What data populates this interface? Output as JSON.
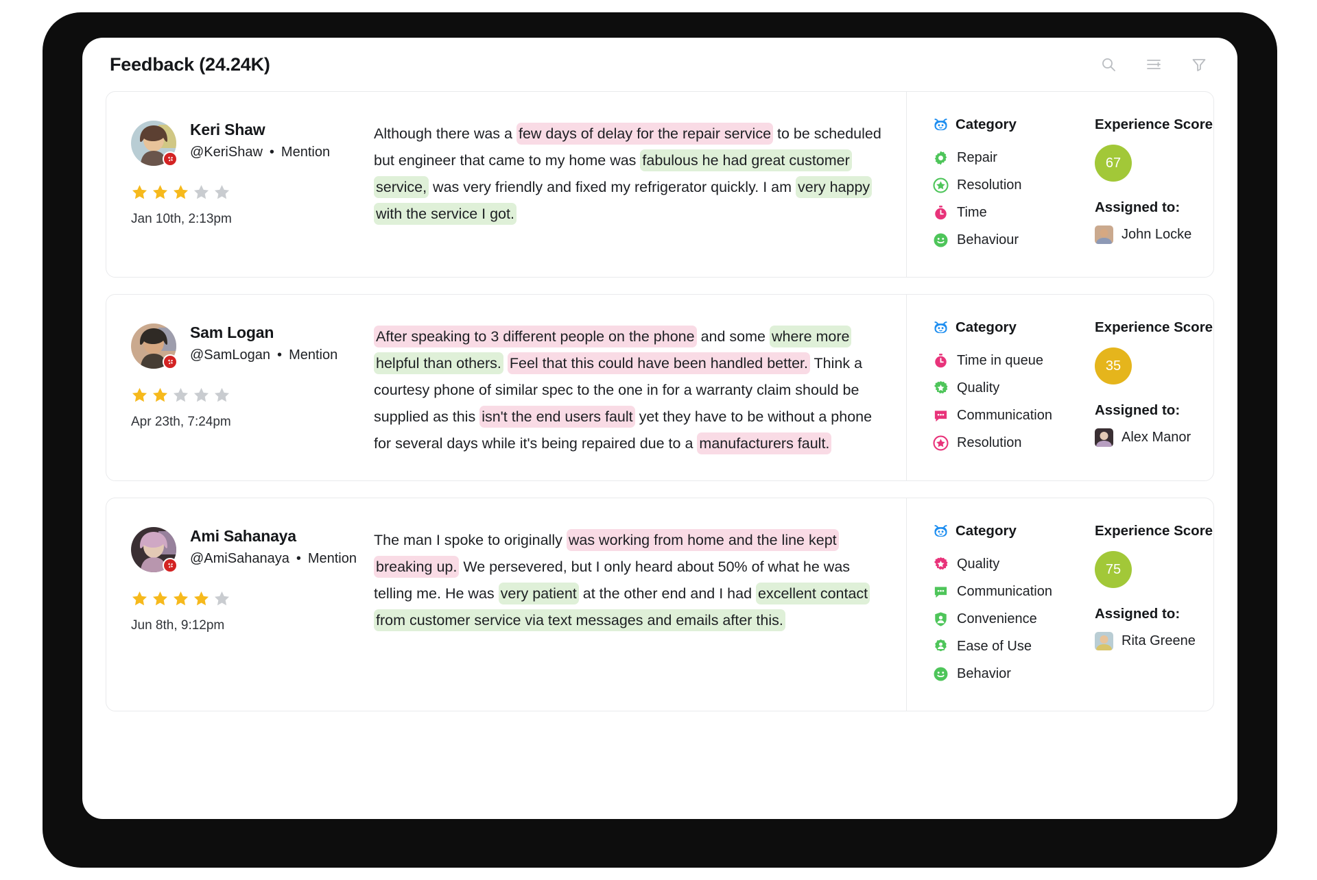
{
  "header": {
    "title": "Feedback (24.24K)",
    "icons": [
      {
        "name": "search-icon",
        "label": "Search"
      },
      {
        "name": "sort-list-icon",
        "label": "Sort"
      },
      {
        "name": "filter-funnel-icon",
        "label": "Filter"
      }
    ]
  },
  "labels": {
    "category": "Category",
    "experience_score": "Experience Score",
    "assigned_to": "Assigned to:",
    "source": "Mention",
    "separator": "•"
  },
  "colors": {
    "score_green": "#a2c838",
    "score_yellow": "#e5b51c",
    "highlight_positive": "#dff0d8",
    "highlight_negative": "#f9dbe5",
    "star_filled": "#f6b91c",
    "star_empty": "#c9ccd0",
    "badge_red": "#d32323",
    "bot_blue": "#1c8df0",
    "icon_green": "#4ec55a",
    "icon_pink": "#e8337a"
  },
  "cards": [
    {
      "user": {
        "name": "Keri Shaw",
        "handle": "@KeriShaw",
        "source": "Mention"
      },
      "rating": 3,
      "rating_max": 5,
      "date": "Jan 10th, 2:13pm",
      "review_segments": [
        {
          "text": "Although there was a ",
          "type": "plain"
        },
        {
          "text": "few days of delay for the repair service",
          "type": "negative"
        },
        {
          "text": " to be scheduled but engineer that came to my home was ",
          "type": "plain"
        },
        {
          "text": "fabulous he had great customer service,",
          "type": "positive"
        },
        {
          "text": " was very friendly and fixed my refrigerator quickly. I am ",
          "type": "plain"
        },
        {
          "text": "very happy with the service I got.",
          "type": "positive"
        }
      ],
      "categories": [
        {
          "label": "Repair",
          "icon": "gear-icon",
          "color": "green"
        },
        {
          "label": "Resolution",
          "icon": "star-circle-icon",
          "color": "green"
        },
        {
          "label": "Time",
          "icon": "stopwatch-icon",
          "color": "pink"
        },
        {
          "label": "Behaviour",
          "icon": "smiley-icon",
          "color": "green"
        }
      ],
      "score": "67",
      "score_color": "#a2c838",
      "assignee": "John Locke"
    },
    {
      "user": {
        "name": "Sam Logan",
        "handle": "@SamLogan",
        "source": "Mention"
      },
      "rating": 2,
      "rating_max": 5,
      "date": "Apr 23th, 7:24pm",
      "review_segments": [
        {
          "text": "After speaking to 3 different people on the phone",
          "type": "negative"
        },
        {
          "text": " and some ",
          "type": "plain"
        },
        {
          "text": "where more helpful than others.",
          "type": "positive"
        },
        {
          "text": " ",
          "type": "plain"
        },
        {
          "text": "Feel that this could have been handled better.",
          "type": "negative"
        },
        {
          "text": " Think a courtesy phone of similar spec to the one in for a warranty claim should be supplied as this ",
          "type": "plain"
        },
        {
          "text": "isn't the end users fault",
          "type": "negative"
        },
        {
          "text": " yet they have to be without a phone for several days while it's being repaired due to a ",
          "type": "plain"
        },
        {
          "text": "manufacturers fault.",
          "type": "negative"
        }
      ],
      "categories": [
        {
          "label": "Time in queue",
          "icon": "stopwatch-icon",
          "color": "pink"
        },
        {
          "label": "Quality",
          "icon": "star-badge-icon",
          "color": "green"
        },
        {
          "label": "Communication",
          "icon": "chat-bubble-icon",
          "color": "pink"
        },
        {
          "label": "Resolution",
          "icon": "star-circle-icon",
          "color": "pink"
        }
      ],
      "score": "35",
      "score_color": "#e5b51c",
      "assignee": "Alex Manor"
    },
    {
      "user": {
        "name": "Ami Sahanaya",
        "handle": "@AmiSahanaya",
        "source": "Mention"
      },
      "rating": 4,
      "rating_max": 5,
      "date": "Jun 8th,  9:12pm",
      "review_segments": [
        {
          "text": "The man I spoke to originally ",
          "type": "plain"
        },
        {
          "text": "was working from home and the line kept breaking up.",
          "type": "negative"
        },
        {
          "text": " We persevered, but I only heard about 50% of what he was telling me. He was ",
          "type": "plain"
        },
        {
          "text": "very patient",
          "type": "positive"
        },
        {
          "text": " at the other end and I had ",
          "type": "plain"
        },
        {
          "text": "excellent contact from customer service via text messages and emails after this.",
          "type": "positive"
        }
      ],
      "categories": [
        {
          "label": "Quality",
          "icon": "star-badge-icon",
          "color": "pink"
        },
        {
          "label": "Communication",
          "icon": "chat-bubble-icon",
          "color": "green"
        },
        {
          "label": "Convenience",
          "icon": "shield-person-icon",
          "color": "green"
        },
        {
          "label": "Ease of Use",
          "icon": "person-badge-icon",
          "color": "green"
        },
        {
          "label": "Behavior",
          "icon": "smiley-icon",
          "color": "green"
        }
      ],
      "score": "75",
      "score_color": "#a2c838",
      "assignee": "Rita Greene"
    }
  ]
}
